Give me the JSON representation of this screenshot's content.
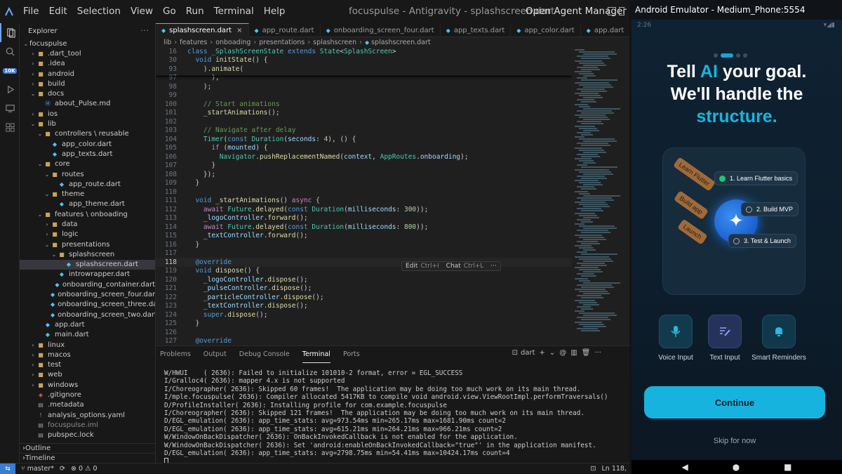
{
  "titlebar": {
    "menu": [
      "File",
      "Edit",
      "Selection",
      "View",
      "Go",
      "Run",
      "Terminal",
      "Help"
    ],
    "window_title": "focuspulse - Antigravity - splashscreen.dart",
    "agent_manager": "Open Agent Manager"
  },
  "activity": {
    "badge": "10K"
  },
  "explorer": {
    "title": "Explorer",
    "root": "focuspulse",
    "items": [
      {
        "label": ".dart_tool",
        "depth": 1,
        "type": "folder",
        "state": "closed"
      },
      {
        "label": ".idea",
        "depth": 1,
        "type": "folder",
        "state": "closed"
      },
      {
        "label": "android",
        "depth": 1,
        "type": "folder",
        "state": "closed"
      },
      {
        "label": "build",
        "depth": 1,
        "type": "folder",
        "state": "closed"
      },
      {
        "label": "docs",
        "depth": 1,
        "type": "folder",
        "state": "open"
      },
      {
        "label": "about_Pulse.md",
        "depth": 2,
        "type": "md"
      },
      {
        "label": "ios",
        "depth": 1,
        "type": "folder",
        "state": "closed"
      },
      {
        "label": "lib",
        "depth": 1,
        "type": "folder",
        "state": "open"
      },
      {
        "label": "controllers \\ reusable",
        "depth": 2,
        "type": "folder",
        "state": "open"
      },
      {
        "label": "app_color.dart",
        "depth": 3,
        "type": "dart"
      },
      {
        "label": "app_texts.dart",
        "depth": 3,
        "type": "dart"
      },
      {
        "label": "core",
        "depth": 2,
        "type": "folder",
        "state": "open"
      },
      {
        "label": "routes",
        "depth": 3,
        "type": "folder",
        "state": "open"
      },
      {
        "label": "app_route.dart",
        "depth": 4,
        "type": "dart"
      },
      {
        "label": "theme",
        "depth": 3,
        "type": "folder",
        "state": "open"
      },
      {
        "label": "app_theme.dart",
        "depth": 4,
        "type": "dart"
      },
      {
        "label": "features \\ onboading",
        "depth": 2,
        "type": "folder",
        "state": "open"
      },
      {
        "label": "data",
        "depth": 3,
        "type": "folder",
        "state": "closed"
      },
      {
        "label": "logic",
        "depth": 3,
        "type": "folder",
        "state": "closed"
      },
      {
        "label": "presentations",
        "depth": 3,
        "type": "folder",
        "state": "open"
      },
      {
        "label": "splashscreen",
        "depth": 4,
        "type": "folder",
        "state": "open"
      },
      {
        "label": "splashscreen.dart",
        "depth": 5,
        "type": "dart",
        "selected": true
      },
      {
        "label": "introwrapper.dart",
        "depth": 4,
        "type": "dart"
      },
      {
        "label": "onboarding_container.dart",
        "depth": 4,
        "type": "dart"
      },
      {
        "label": "onboarding_screen_four.dart",
        "depth": 4,
        "type": "dart"
      },
      {
        "label": "onboarding_screen_three.dart",
        "depth": 4,
        "type": "dart"
      },
      {
        "label": "onboarding_screen_two.dart",
        "depth": 4,
        "type": "dart"
      },
      {
        "label": "app.dart",
        "depth": 2,
        "type": "dart"
      },
      {
        "label": "main.dart",
        "depth": 2,
        "type": "dart"
      },
      {
        "label": "linux",
        "depth": 1,
        "type": "folder",
        "state": "closed"
      },
      {
        "label": "macos",
        "depth": 1,
        "type": "folder",
        "state": "closed"
      },
      {
        "label": "test",
        "depth": 1,
        "type": "folder",
        "state": "closed"
      },
      {
        "label": "web",
        "depth": 1,
        "type": "folder",
        "state": "closed"
      },
      {
        "label": "windows",
        "depth": 1,
        "type": "folder",
        "state": "closed"
      },
      {
        "label": ".gitignore",
        "depth": 1,
        "type": "git"
      },
      {
        "label": ".metadata",
        "depth": 1,
        "type": "file"
      },
      {
        "label": "analysis_options.yaml",
        "depth": 1,
        "type": "yaml"
      },
      {
        "label": "focuspulse.iml",
        "depth": 1,
        "type": "file",
        "gray": true
      },
      {
        "label": "pubspec.lock",
        "depth": 1,
        "type": "file"
      }
    ],
    "outline": "Outline",
    "timeline": "Timeline"
  },
  "tabs": [
    {
      "label": "splashscreen.dart",
      "active": true
    },
    {
      "label": "app_route.dart"
    },
    {
      "label": "onboarding_screen_four.dart"
    },
    {
      "label": "app_texts.dart"
    },
    {
      "label": "app_color.dart"
    },
    {
      "label": "app.dart"
    }
  ],
  "breadcrumb": [
    "lib",
    "features",
    "onboading",
    "presentations",
    "splashscreen",
    "splashscreen.dart"
  ],
  "code": [
    {
      "ln": "16",
      "tokens": [
        [
          "kw",
          "class "
        ],
        [
          "ty",
          "_SplashScreenState "
        ],
        [
          "kw",
          "extends "
        ],
        [
          "ty",
          "State"
        ],
        [
          "",
          "<"
        ],
        [
          "ty",
          "SplashScreen"
        ],
        [
          "",
          "> "
        ]
      ]
    },
    {
      "ln": "30",
      "tokens": [
        [
          "",
          "  "
        ],
        [
          "kw",
          "void "
        ],
        [
          "fn",
          "initState"
        ],
        [
          "",
          "() {"
        ]
      ]
    },
    {
      "ln": "93",
      "tokens": [
        [
          "",
          "    )."
        ],
        [
          "fn",
          "animate"
        ],
        [
          "",
          "("
        ]
      ]
    },
    {
      "ln": "97",
      "tokens": [
        [
          "",
          "      ),"
        ]
      ]
    },
    {
      "ln": "98",
      "tokens": [
        [
          "",
          "    );"
        ]
      ]
    },
    {
      "ln": "99",
      "tokens": [
        [
          "",
          ""
        ]
      ]
    },
    {
      "ln": "100",
      "tokens": [
        [
          "",
          "    "
        ],
        [
          "cm",
          "// Start animations"
        ]
      ]
    },
    {
      "ln": "101",
      "tokens": [
        [
          "",
          "    "
        ],
        [
          "fn",
          "_startAnimations"
        ],
        [
          "",
          "();"
        ]
      ]
    },
    {
      "ln": "102",
      "tokens": [
        [
          "",
          ""
        ]
      ]
    },
    {
      "ln": "103",
      "tokens": [
        [
          "",
          "    "
        ],
        [
          "cm",
          "// Navigate after delay"
        ]
      ]
    },
    {
      "ln": "104",
      "tokens": [
        [
          "",
          "    "
        ],
        [
          "ty",
          "Timer"
        ],
        [
          "",
          "("
        ],
        [
          "kw",
          "const "
        ],
        [
          "ty",
          "Duration"
        ],
        [
          "",
          "("
        ],
        [
          "var",
          "seconds"
        ],
        [
          "",
          ": "
        ],
        [
          "num",
          "4"
        ],
        [
          "",
          "), () {"
        ]
      ]
    },
    {
      "ln": "105",
      "tokens": [
        [
          "",
          "      "
        ],
        [
          "ctl",
          "if "
        ],
        [
          "",
          "("
        ],
        [
          "var",
          "mounted"
        ],
        [
          "",
          ") {"
        ]
      ]
    },
    {
      "ln": "106",
      "tokens": [
        [
          "",
          "        "
        ],
        [
          "ty",
          "Navigator"
        ],
        [
          "",
          "."
        ],
        [
          "fn",
          "pushReplacementNamed"
        ],
        [
          "",
          "("
        ],
        [
          "var",
          "context"
        ],
        [
          "",
          ", "
        ],
        [
          "ty",
          "AppRoutes"
        ],
        [
          "",
          "."
        ],
        [
          "var",
          "onboarding"
        ],
        [
          "",
          ");"
        ]
      ]
    },
    {
      "ln": "107",
      "tokens": [
        [
          "",
          "      }"
        ]
      ]
    },
    {
      "ln": "108",
      "tokens": [
        [
          "",
          "    });"
        ]
      ]
    },
    {
      "ln": "109",
      "tokens": [
        [
          "",
          "  }"
        ]
      ]
    },
    {
      "ln": "110",
      "tokens": [
        [
          "",
          ""
        ]
      ]
    },
    {
      "ln": "111",
      "tokens": [
        [
          "",
          "  "
        ],
        [
          "kw",
          "void "
        ],
        [
          "fn",
          "_startAnimations"
        ],
        [
          "",
          "() "
        ],
        [
          "ctl",
          "async "
        ],
        [
          "",
          "{"
        ]
      ]
    },
    {
      "ln": "112",
      "tokens": [
        [
          "",
          "    "
        ],
        [
          "ctl",
          "await "
        ],
        [
          "ty",
          "Future"
        ],
        [
          "",
          "."
        ],
        [
          "fn",
          "delayed"
        ],
        [
          "",
          "("
        ],
        [
          "kw",
          "const "
        ],
        [
          "ty",
          "Duration"
        ],
        [
          "",
          "("
        ],
        [
          "var",
          "milliseconds"
        ],
        [
          "",
          ": "
        ],
        [
          "num",
          "300"
        ],
        [
          "",
          "));"
        ]
      ]
    },
    {
      "ln": "113",
      "tokens": [
        [
          "",
          "    "
        ],
        [
          "var",
          "_logoController"
        ],
        [
          "",
          "."
        ],
        [
          "fn",
          "forward"
        ],
        [
          "",
          "();"
        ]
      ]
    },
    {
      "ln": "114",
      "tokens": [
        [
          "",
          "    "
        ],
        [
          "ctl",
          "await "
        ],
        [
          "ty",
          "Future"
        ],
        [
          "",
          "."
        ],
        [
          "fn",
          "delayed"
        ],
        [
          "",
          "("
        ],
        [
          "kw",
          "const "
        ],
        [
          "ty",
          "Duration"
        ],
        [
          "",
          "("
        ],
        [
          "var",
          "milliseconds"
        ],
        [
          "",
          ": "
        ],
        [
          "num",
          "800"
        ],
        [
          "",
          "));"
        ]
      ]
    },
    {
      "ln": "115",
      "tokens": [
        [
          "",
          "    "
        ],
        [
          "var",
          "_textController"
        ],
        [
          "",
          "."
        ],
        [
          "fn",
          "forward"
        ],
        [
          "",
          "();"
        ]
      ]
    },
    {
      "ln": "116",
      "tokens": [
        [
          "",
          "  }"
        ]
      ]
    },
    {
      "ln": "117",
      "tokens": [
        [
          "",
          ""
        ]
      ]
    },
    {
      "ln": "118",
      "tokens": [
        [
          "",
          "  "
        ],
        [
          "kw",
          "@override"
        ]
      ],
      "current": true
    },
    {
      "ln": "119",
      "tokens": [
        [
          "",
          "  "
        ],
        [
          "kw",
          "void "
        ],
        [
          "fn",
          "dispose"
        ],
        [
          "",
          "() {"
        ]
      ]
    },
    {
      "ln": "120",
      "tokens": [
        [
          "",
          "    "
        ],
        [
          "var",
          "_logoController"
        ],
        [
          "",
          "."
        ],
        [
          "fn",
          "dispose"
        ],
        [
          "",
          "();"
        ]
      ]
    },
    {
      "ln": "121",
      "tokens": [
        [
          "",
          "    "
        ],
        [
          "var",
          "_pulseController"
        ],
        [
          "",
          "."
        ],
        [
          "fn",
          "dispose"
        ],
        [
          "",
          "();"
        ]
      ]
    },
    {
      "ln": "122",
      "tokens": [
        [
          "",
          "    "
        ],
        [
          "var",
          "_particleController"
        ],
        [
          "",
          "."
        ],
        [
          "fn",
          "dispose"
        ],
        [
          "",
          "();"
        ]
      ]
    },
    {
      "ln": "123",
      "tokens": [
        [
          "",
          "    "
        ],
        [
          "var",
          "_textController"
        ],
        [
          "",
          "."
        ],
        [
          "fn",
          "dispose"
        ],
        [
          "",
          "();"
        ]
      ]
    },
    {
      "ln": "124",
      "tokens": [
        [
          "",
          "    "
        ],
        [
          "kw",
          "super"
        ],
        [
          "",
          "."
        ],
        [
          "fn",
          "dispose"
        ],
        [
          "",
          "();"
        ]
      ]
    },
    {
      "ln": "125",
      "tokens": [
        [
          "",
          "  }"
        ]
      ]
    },
    {
      "ln": "126",
      "tokens": [
        [
          "",
          ""
        ]
      ]
    },
    {
      "ln": "127",
      "tokens": [
        [
          "",
          "  "
        ],
        [
          "kw",
          "@override"
        ]
      ]
    }
  ],
  "inline_hint": {
    "edit": "Edit",
    "edit_key": "Ctrl+I",
    "chat": "Chat",
    "chat_key": "Ctrl+L",
    "more": "···"
  },
  "panel": {
    "tabs": [
      "Problems",
      "Output",
      "Debug Console",
      "Terminal",
      "Ports"
    ],
    "active_tab": "Terminal",
    "terminal_label": "dart",
    "lines": [
      "W/HWUI    ( 2636): Failed to initialize 101010-2 format, error = EGL_SUCCESS",
      "I/Gralloc4( 2636): mapper 4.x is not supported",
      "I/Choreographer( 2636): Skipped 60 frames!  The application may be doing too much work on its main thread.",
      "I/mple.focuspulse( 2636): Compiler allocated 5417KB to compile void android.view.ViewRootImpl.performTraversals()",
      "D/ProfileInstaller( 2636): Installing profile for com.example.focuspulse",
      "I/Choreographer( 2636): Skipped 121 frames!  The application may be doing too much work on its main thread.",
      "D/EGL_emulation( 2636): app_time_stats: avg=973.54ms min=265.17ms max=1681.90ms count=2",
      "D/EGL_emulation( 2636): app_time_stats: avg=615.21ms min=264.21ms max=966.21ms count=2",
      "W/WindowOnBackDispatcher( 2636): OnBackInvokedCallback is not enabled for the application.",
      "W/WindowOnBackDispatcher( 2636): Set 'android:enableOnBackInvokedCallback=\"true\"' in the application manifest.",
      "D/EGL_emulation( 2636): app_time_stats: avg=2798.75ms min=54.41ms max=10424.17ms count=4"
    ]
  },
  "status": {
    "branch": "master*",
    "problems": "0 ⚠ 0",
    "position": "Ln 118,"
  },
  "emulator": {
    "title": "Android Emulator - Medium_Phone:5554",
    "time": "2:26",
    "headline": {
      "l1a": "Tell ",
      "l1b": "AI",
      "l1c": " your goal.",
      "l2": "We'll handle the",
      "l3": "structure."
    },
    "sticks": [
      "Learn Flutter",
      "Build app",
      "Launch"
    ],
    "steps": [
      {
        "label": "1. Learn Flutter basics",
        "done": true
      },
      {
        "label": "2. Build MVP",
        "done": false
      },
      {
        "label": "3. Test & Launch",
        "done": false
      }
    ],
    "features": [
      {
        "label": "Voice Input",
        "icon": "mic-icon"
      },
      {
        "label": "Text Input",
        "icon": "edit-icon"
      },
      {
        "label": "Smart Reminders",
        "icon": "bell-icon"
      }
    ],
    "continue_label": "Continue",
    "skip_label": "Skip for now",
    "colors": {
      "accent": "#17b3df",
      "background": "#0d1d2b"
    }
  }
}
